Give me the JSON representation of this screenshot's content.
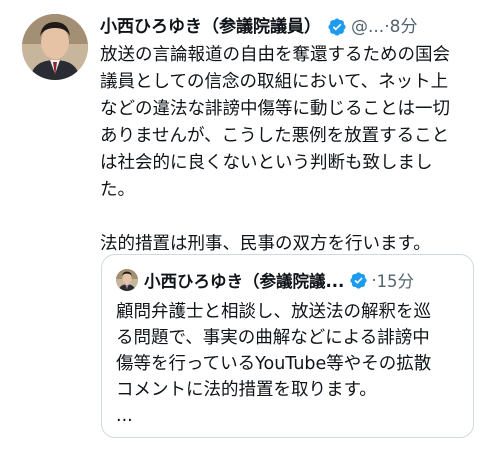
{
  "tweet": {
    "author": {
      "display_name": "小西ひろゆき（参議院議員）",
      "handle": "@...",
      "avatar_icon": "profile-photo"
    },
    "separator": "·",
    "time": "8分",
    "body_lines": [
      "放送の言論報道の自由を奪還するための国会",
      "議員としての信念の取組において、ネット上",
      "などの違法な誹謗中傷等に動じることは一切",
      "ありませんが、こうした悪例を放置すること",
      "は社会的に良くないという判断も致しまし",
      "た。"
    ],
    "body_line2": "法的措置は刑事、民事の双方を行います。"
  },
  "quoted": {
    "author": {
      "display_name": "小西ひろゆき（参議院議...",
      "avatar_icon": "profile-photo"
    },
    "separator": "·",
    "time": "15分",
    "body_lines": [
      "顧問弁護士と相談し、放送法の解釈を巡",
      "る問題で、事実の曲解などによる誹謗中",
      "傷等を行っているYouTube等やその拡散",
      "コメントに法的措置を取ります。",
      "..."
    ]
  },
  "colors": {
    "text": "#0f1419",
    "secondary": "#536471",
    "verified_badge": "#1d9bf0",
    "border": "#cfd9de"
  }
}
